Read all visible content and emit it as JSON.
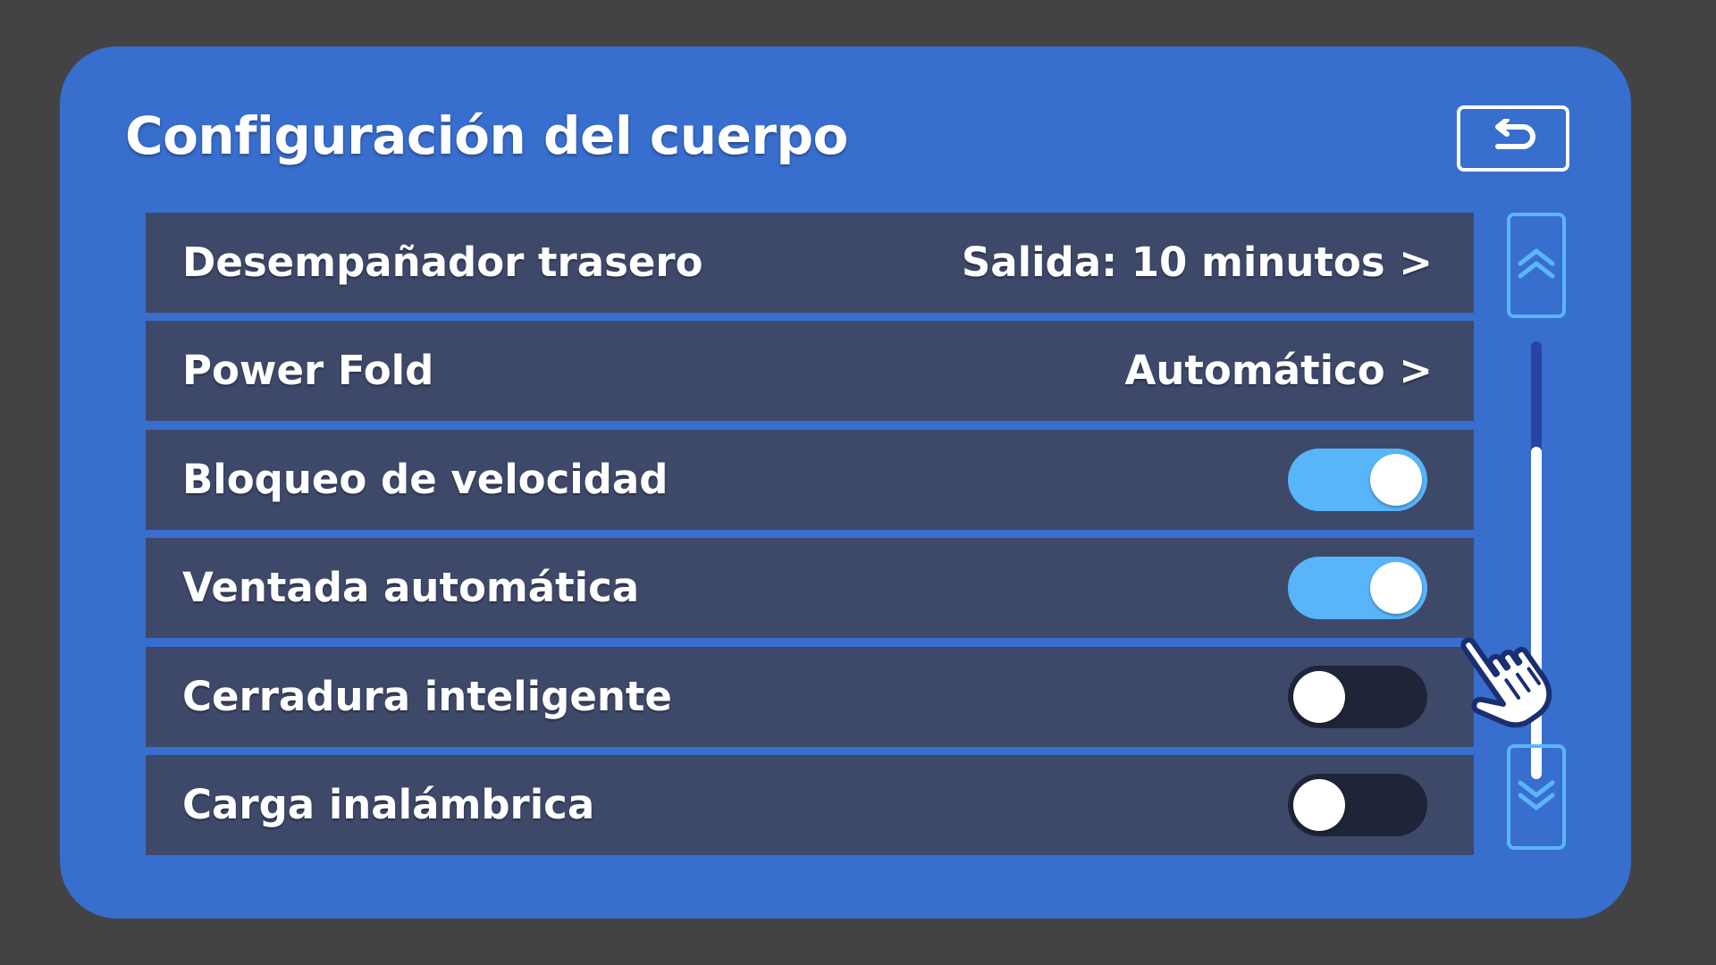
{
  "header": {
    "title": "Configuración del cuerpo",
    "back_icon": "back-arrow-icon"
  },
  "settings": [
    {
      "label": "Desempañador trasero",
      "type": "value",
      "value": "Salida: 10 minutos >"
    },
    {
      "label": "Power Fold",
      "type": "value",
      "value": "Automático >"
    },
    {
      "label": "Bloqueo de velocidad",
      "type": "toggle",
      "on": true
    },
    {
      "label": "Ventada automática",
      "type": "toggle",
      "on": true
    },
    {
      "label": "Cerradura inteligente",
      "type": "toggle",
      "on": false
    },
    {
      "label": "Carga inalámbrica",
      "type": "toggle",
      "on": false
    }
  ],
  "scrollbar": {
    "up_icon": "double-chevron-up-icon",
    "down_icon": "double-chevron-down-icon",
    "position_fraction": 0.24,
    "visible_fraction": 0.76
  },
  "pointer": {
    "icon": "hand-pointer-icon"
  },
  "colors": {
    "background": "#434346",
    "panel": "#386ecd",
    "row": "#3e4869",
    "toggle_on": "#58b5f9",
    "toggle_off": "#1f2538",
    "scroll_accent": "#5ab6fb",
    "text": "#ffffff"
  }
}
